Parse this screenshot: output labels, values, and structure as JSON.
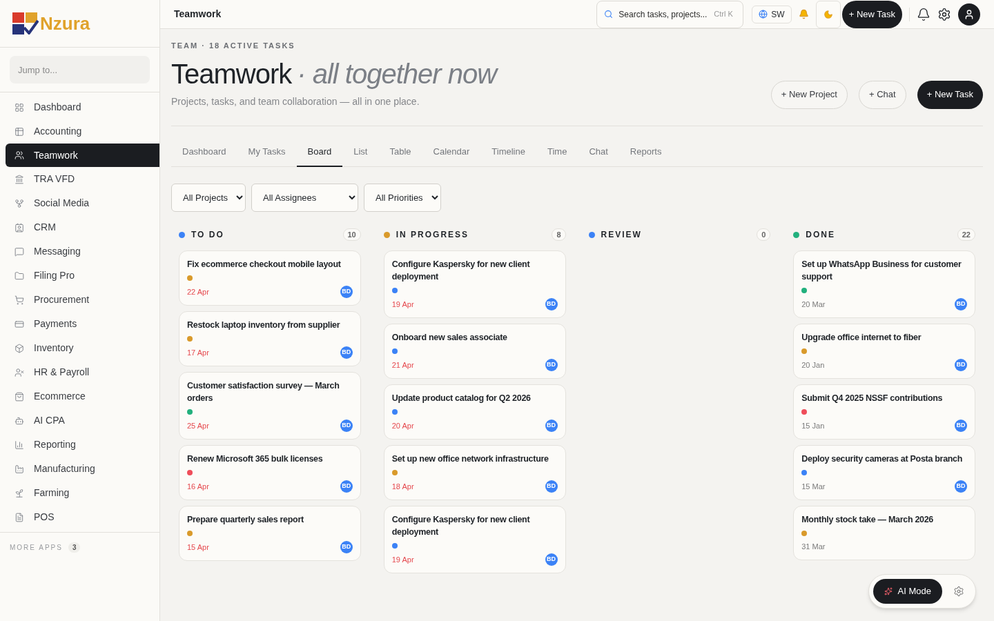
{
  "logo": {
    "text": "Nzura"
  },
  "sidebar": {
    "search": {
      "placeholder": "Jump to..."
    },
    "items": [
      {
        "label": "Dashboard",
        "selected": false
      },
      {
        "label": "Accounting",
        "selected": false
      },
      {
        "label": "Teamwork",
        "selected": true
      },
      {
        "label": "TRA VFD",
        "selected": false
      },
      {
        "label": "Social Media",
        "selected": false
      },
      {
        "label": "CRM",
        "selected": false
      },
      {
        "label": "Messaging",
        "selected": false
      },
      {
        "label": "Filing Pro",
        "selected": false
      },
      {
        "label": "Procurement",
        "selected": false
      },
      {
        "label": "Payments",
        "selected": false
      },
      {
        "label": "Inventory",
        "selected": false
      },
      {
        "label": "HR & Payroll",
        "selected": false
      },
      {
        "label": "Ecommerce",
        "selected": false
      },
      {
        "label": "AI CPA",
        "selected": false
      },
      {
        "label": "Reporting",
        "selected": false
      },
      {
        "label": "Manufacturing",
        "selected": false
      },
      {
        "label": "Farming",
        "selected": false
      },
      {
        "label": "POS",
        "selected": false
      }
    ],
    "more_apps": {
      "label": "MORE APPS",
      "count": "3"
    }
  },
  "topbar": {
    "title": "Teamwork",
    "search": {
      "placeholder": "Search tasks, projects...",
      "shortcut": "Ctrl K"
    },
    "language": "SW",
    "new_task": "+ New Task"
  },
  "header": {
    "eyebrow": "TEAM · 18 ACTIVE TASKS",
    "title": "Teamwork",
    "subtitle": "· all together now",
    "description": "Projects, tasks, and team collaboration — all in one place.",
    "buttons": [
      {
        "label": "+ New Project",
        "kind": "outline"
      },
      {
        "label": "+ Chat",
        "kind": "outline"
      },
      {
        "label": "+ New Task",
        "kind": "solid"
      }
    ]
  },
  "tabs": [
    {
      "label": "Dashboard",
      "selected": false
    },
    {
      "label": "My Tasks",
      "selected": false
    },
    {
      "label": "Board",
      "selected": true
    },
    {
      "label": "List",
      "selected": false
    },
    {
      "label": "Table",
      "selected": false
    },
    {
      "label": "Calendar",
      "selected": false
    },
    {
      "label": "Timeline",
      "selected": false
    },
    {
      "label": "Time",
      "selected": false
    },
    {
      "label": "Chat",
      "selected": false
    },
    {
      "label": "Reports",
      "selected": false
    }
  ],
  "filters": [
    "All Projects",
    "All Assignees",
    "All Priorities"
  ],
  "columns": [
    {
      "title": "TO DO",
      "count": "10",
      "color": "#3b82f6",
      "cards": [
        {
          "title": "Fix ecommerce checkout mobile layout",
          "color": "#d99a2b",
          "date": "22 Apr",
          "overdue": true,
          "assignee": "BD"
        },
        {
          "title": "Restock laptop inventory from supplier",
          "color": "#d99a2b",
          "date": "17 Apr",
          "overdue": true,
          "assignee": "BD"
        },
        {
          "title": "Customer satisfaction survey — March orders",
          "color": "#22b07d",
          "date": "25 Apr",
          "overdue": true,
          "assignee": "BD"
        },
        {
          "title": "Renew Microsoft 365 bulk licenses",
          "color": "#ef4d5a",
          "date": "16 Apr",
          "overdue": true,
          "assignee": "BD"
        },
        {
          "title": "Prepare quarterly sales report",
          "color": "#d99a2b",
          "date": "15 Apr",
          "overdue": true,
          "assignee": "BD"
        }
      ]
    },
    {
      "title": "IN PROGRESS",
      "count": "8",
      "color": "#d99a2b",
      "cards": [
        {
          "title": "Configure Kaspersky for new client deployment",
          "color": "#3b82f6",
          "date": "19 Apr",
          "overdue": true,
          "assignee": "BD"
        },
        {
          "title": "Onboard new sales associate",
          "color": "#3b82f6",
          "date": "21 Apr",
          "overdue": true,
          "assignee": "BD"
        },
        {
          "title": "Update product catalog for Q2 2026",
          "color": "#3b82f6",
          "date": "20 Apr",
          "overdue": true,
          "assignee": "BD"
        },
        {
          "title": "Set up new office network infrastructure",
          "color": "#d99a2b",
          "date": "18 Apr",
          "overdue": true,
          "assignee": "BD"
        },
        {
          "title": "Configure Kaspersky for new client deployment",
          "color": "#3b82f6",
          "date": "19 Apr",
          "overdue": true,
          "assignee": "BD"
        }
      ]
    },
    {
      "title": "REVIEW",
      "count": "0",
      "color": "#3b82f6"
    },
    {
      "title": "DONE",
      "count": "22",
      "color": "#22b07d",
      "cards": [
        {
          "title": "Set up WhatsApp Business for customer support",
          "color": "#22b07d",
          "date": "20 Mar",
          "overdue": false,
          "assignee": "BD"
        },
        {
          "title": "Upgrade office internet to fiber",
          "color": "#d99a2b",
          "date": "20 Jan",
          "overdue": false,
          "assignee": "BD"
        },
        {
          "title": "Submit Q4 2025 NSSF contributions",
          "color": "#ef4d5a",
          "date": "15 Jan",
          "overdue": false,
          "assignee": "BD"
        },
        {
          "title": "Deploy security cameras at Posta branch",
          "color": "#3b82f6",
          "date": "15 Mar",
          "overdue": false,
          "assignee": "BD"
        },
        {
          "title": "Monthly stock take — March 2026",
          "color": "#d99a2b",
          "date": "31 Mar",
          "overdue": false
        }
      ]
    }
  ],
  "ai_mode": {
    "label": "AI Mode"
  }
}
